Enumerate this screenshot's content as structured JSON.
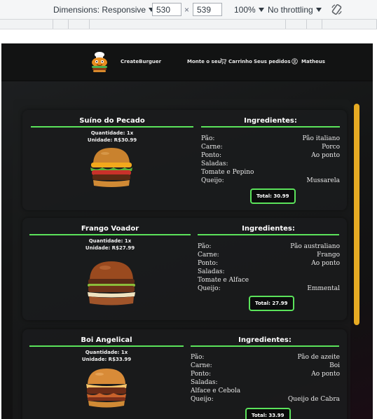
{
  "devtools": {
    "dimensions_label": "Dimensions: Responsive",
    "width_value": "530",
    "times_sign": "×",
    "height_value": "539",
    "zoom_label": "100%",
    "throttling_label": "No throttling"
  },
  "nav": {
    "brand": "CreateBurguer",
    "links": [
      "Monte o seu",
      "Carrinho",
      "Seus pedidos",
      "Matheus"
    ]
  },
  "orders": [
    {
      "name": "Suíno do Pecado",
      "quantity": "Quantidade: 1x",
      "unit_price": "Unidade: R$30.99",
      "ingredients_title": "Ingredientes:",
      "rows": [
        {
          "label": "Pão:",
          "value": "Pão italiano"
        },
        {
          "label": "Carne:",
          "value": "Porco"
        },
        {
          "label": "Ponto:",
          "value": "Ao ponto"
        },
        {
          "label": "Saladas:",
          "value": ""
        },
        {
          "label": "Tomate e Pepino",
          "value": ""
        },
        {
          "label": "Queijo:",
          "value": "Mussarela"
        }
      ],
      "total": "Total: 30.99"
    },
    {
      "name": "Frango Voador",
      "quantity": "Quantidade: 1x",
      "unit_price": "Unidade: R$27.99",
      "ingredients_title": "Ingredientes:",
      "rows": [
        {
          "label": "Pão:",
          "value": "Pão australiano"
        },
        {
          "label": "Carne:",
          "value": "Frango"
        },
        {
          "label": "Ponto:",
          "value": "Ao ponto"
        },
        {
          "label": "Saladas:",
          "value": ""
        },
        {
          "label": "Tomate e Alface",
          "value": ""
        },
        {
          "label": "Queijo:",
          "value": "Emmental"
        }
      ],
      "total": "Total: 27.99"
    },
    {
      "name": "Boi Angelical",
      "quantity": "Quantidade: 1x",
      "unit_price": "Unidade: R$33.99",
      "ingredients_title": "Ingredientes:",
      "rows": [
        {
          "label": "Pão:",
          "value": "Pão de azeite"
        },
        {
          "label": "Carne:",
          "value": "Boi"
        },
        {
          "label": "Ponto:",
          "value": "Ao ponto"
        },
        {
          "label": "Saladas:",
          "value": ""
        },
        {
          "label": "Alface e Cebola",
          "value": ""
        },
        {
          "label": "Queijo:",
          "value": "Queijo de Cabra"
        }
      ],
      "total": "Total: 33.99"
    }
  ],
  "colors": {
    "accent_green": "#5be35b",
    "scrollbar": "#e6aa23",
    "background": "#141515"
  },
  "icons": [
    "rotate-icon",
    "burger-logo-icon",
    "cart-icon",
    "user-icon"
  ]
}
